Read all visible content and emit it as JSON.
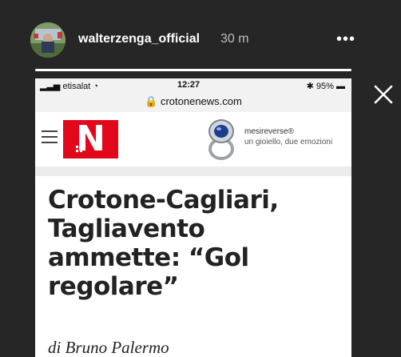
{
  "story": {
    "username": "walterzenga_official",
    "time_ago": "30 m",
    "more_label": "•••",
    "progress": 1.0
  },
  "screenshot": {
    "status_bar": {
      "carrier": "etisalat",
      "time": "12:27",
      "battery": "95%"
    },
    "url": "crotonenews.com",
    "site_logo_letter": "N",
    "ad": {
      "brand": "mesireverse®",
      "tagline": "un gioiello, due emozioni"
    },
    "article": {
      "title": "Crotone-Cagliari, Tagliavento ammette: “Gol regolare”",
      "byline": "di Bruno Palermo"
    }
  },
  "colors": {
    "background": "#262626",
    "logo_red": "#e3071b"
  }
}
